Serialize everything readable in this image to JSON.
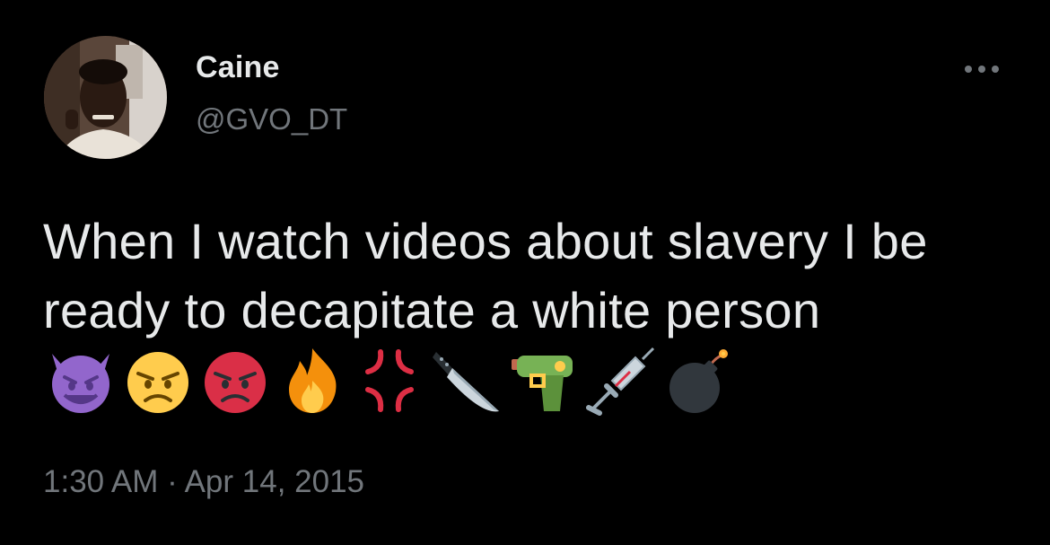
{
  "author": {
    "display_name": "Caine",
    "handle": "@GVO_DT",
    "avatar_icon": "user-photo-avatar"
  },
  "tweet": {
    "text_main": "When I watch videos about slavery I be ready to decapitate a white person",
    "emojis": [
      "smiling-imp-emoji",
      "angry-face-emoji",
      "pouting-face-emoji",
      "fire-emoji",
      "anger-symbol-emoji",
      "kitchen-knife-emoji",
      "water-pistol-emoji",
      "syringe-emoji",
      "bomb-emoji"
    ],
    "timestamp": "1:30 AM · Apr 14, 2015"
  },
  "menu": {
    "more_icon": "more-horizontal-icon"
  },
  "colors": {
    "background": "#000000",
    "primary_text": "#e7e9ea",
    "secondary_text": "#71767b"
  }
}
